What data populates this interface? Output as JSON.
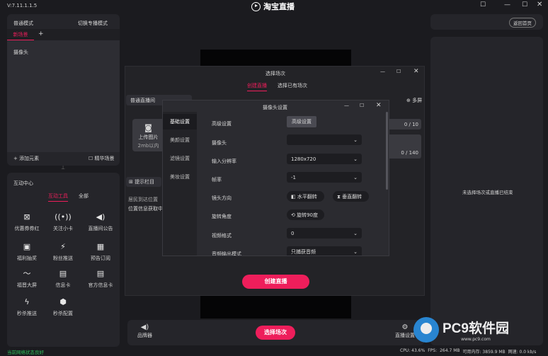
{
  "titlebar": {
    "version": "V:7.11.1.1.5",
    "app_title": "淘宝直播"
  },
  "left_top": {
    "mode_label": "普通模式",
    "switch_mode": "切换专播模式",
    "scene_tab": "新场景",
    "add_tab": "+",
    "source_item": "摄像头",
    "add_source": "+ 添加元素",
    "collect_label": "☐ 精华场景"
  },
  "interactive": {
    "title": "互动中心",
    "tabs": [
      "互动工具",
      "全部"
    ],
    "items": [
      {
        "icon": "gift-box-icon",
        "glyph": "⊠",
        "label": "优惠券券红"
      },
      {
        "icon": "signal-icon",
        "glyph": "((•))",
        "label": "关注小卡"
      },
      {
        "icon": "speaker-icon",
        "glyph": "◀)",
        "label": "直播间公告"
      },
      {
        "icon": "gift-icon",
        "glyph": "▣",
        "label": "福利抽奖"
      },
      {
        "icon": "flash-icon",
        "glyph": "⚡",
        "label": "粉丝推送"
      },
      {
        "icon": "calendar-icon",
        "glyph": "▦",
        "label": "预告订阅"
      },
      {
        "icon": "chart-icon",
        "glyph": "〜",
        "label": "福晋大屏"
      },
      {
        "icon": "card-icon",
        "glyph": "▤",
        "label": "信息卡"
      },
      {
        "icon": "store-card-icon",
        "glyph": "▤",
        "label": "官方信息卡"
      },
      {
        "icon": "lightning-icon",
        "glyph": "ϟ",
        "label": "秒杀推送"
      },
      {
        "icon": "network-icon",
        "glyph": "⬢",
        "label": "秒杀配置"
      }
    ],
    "status": "当前网络状态良好"
  },
  "choose_dialog": {
    "title": "选择场次",
    "tabs": [
      "创建直播",
      "选择已有场次"
    ],
    "select_label": "普通直播间",
    "right_label": "⊕ 多屏",
    "upload_label": "上传图片",
    "upload_hint": "2mb以内",
    "counter1": "0 / 10",
    "counter2": "0 / 140",
    "desc_btn": "⊞ 提示栏目",
    "location_label": "居民到达位置",
    "location_value": "位置信息获取中: 无",
    "create_button": "创建直播"
  },
  "camera_dialog": {
    "title": "摄像头设置",
    "sidebar": [
      "基础设置",
      "美颜设置",
      "滤镜设置",
      "美妆设置"
    ],
    "rows": [
      {
        "label": "高级设置",
        "value": "高级设置"
      },
      {
        "label": "摄像头",
        "value": ""
      },
      {
        "label": "输入分辨率",
        "value": "1280x720"
      },
      {
        "label": "帧率",
        "value": "-1"
      },
      {
        "label": "镜头方向",
        "value": "◧ 水平翻转",
        "value2": "⧗ 垂直翻转"
      },
      {
        "label": "旋转角度",
        "value": "⟲ 旋转90度"
      },
      {
        "label": "视频格式",
        "value": "0"
      },
      {
        "label": "音频输出模式",
        "value": "只捕获音频"
      }
    ]
  },
  "bottom": {
    "beauty_label": "品牌器",
    "choose_button": "选择场次",
    "settings_label": "直播设置"
  },
  "right_panel": {
    "back_button": "返回首页",
    "empty_text": "未选择场次或直播已结束"
  },
  "status_bar": {
    "cpu": "CPU: 43.6%",
    "fps_prefix": "FPS:",
    "mem": "264.7 MB",
    "avail": "可用内存: 3859.9 MB",
    "speed": "网速: 0.0 kb/s"
  },
  "watermark": {
    "brand": "PC9软件园",
    "url": "www.pc9.com"
  },
  "colors": {
    "accent": "#ee1e5b",
    "panel": "#25252a",
    "bg": "#1b1b1f"
  }
}
